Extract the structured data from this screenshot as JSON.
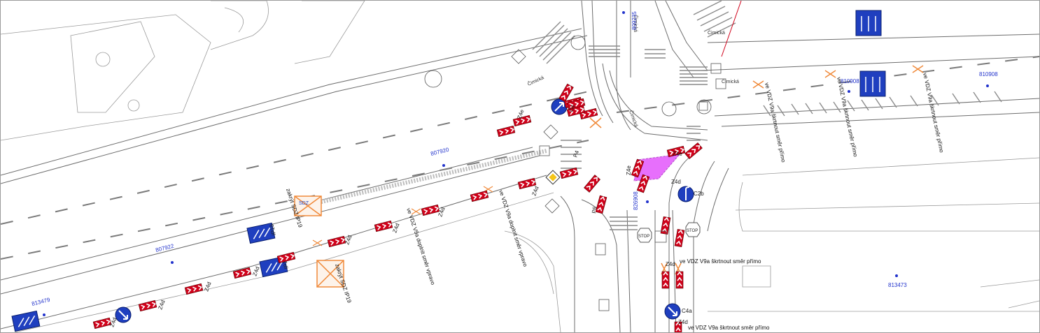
{
  "colors": {
    "line": "#6d6d6d",
    "sign_blue": "#1f3fbf",
    "barrier_red": "#d0021b",
    "barrier_yellow": "#f5c518",
    "cancel_orange": "#f08a3a",
    "work_zone_magenta": "#e040fb",
    "id_blue": "#2233cc"
  },
  "streets": [
    {
      "name": "Čimická"
    },
    {
      "name": "Čimická"
    },
    {
      "name": "Čimická"
    },
    {
      "name": "Čimická"
    },
    {
      "name": "Čimická"
    }
  ],
  "node_ids": [
    "807922",
    "807920",
    "813479",
    "809235",
    "810908",
    "810908",
    "813473",
    "826908"
  ],
  "sign_codes": {
    "z4d": "Z4d",
    "z4e": "Z4e",
    "c4a": "C4a",
    "c2b": "C2b",
    "c4": "C4",
    "ip19": "IP19",
    "p6": "P6",
    "p4": "P4",
    "stop": "STOP",
    "sdz": "SDZ",
    "ip19b": "IP19"
  },
  "notes": [
    {
      "text": "ve VDZ V9a doplnit směr vpravo"
    },
    {
      "text": "ve VDZ V9a doplnit směr vpravo"
    },
    {
      "text": "zakrýt SDZ IP19"
    },
    {
      "text": "zakrýt SDZ IP19"
    },
    {
      "text": "ve VDZ V9a škrtnout směr přímo"
    },
    {
      "text": "ve VDZ V9a škrtnout směr přímo"
    },
    {
      "text": "ve VDZ V9a škrtnout směr přímo"
    },
    {
      "text": "ve VDZ V9a škrtnout směr přímo"
    },
    {
      "text": "ve VDZ V9a škrtnout směr přímo"
    },
    {
      "text": "Z4e"
    }
  ]
}
